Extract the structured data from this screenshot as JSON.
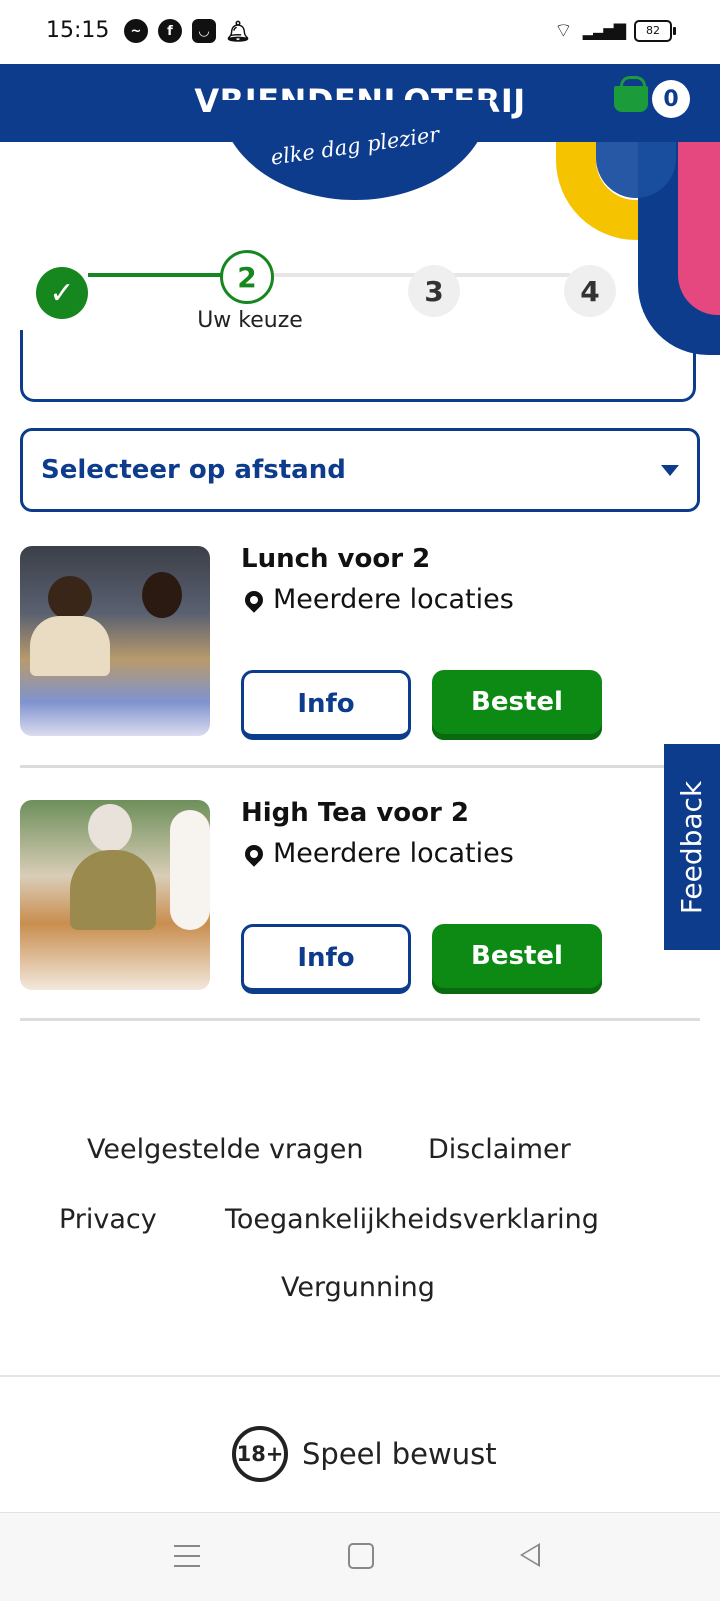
{
  "status_bar": {
    "time": "15:15",
    "battery": "82",
    "notification_icons": [
      "messenger-icon",
      "facebook-icon",
      "app-icon",
      "bell-icon"
    ]
  },
  "header": {
    "brand": "VRIENDENLOTERIJ",
    "tagline": "elke dag plezier",
    "cart_count": "0",
    "colors": {
      "brand_blue": "#0d3c8c",
      "accent_green": "#15871e",
      "yellow": "#f6c300",
      "pink": "#e5477f"
    }
  },
  "stepper": {
    "steps": [
      "1",
      "2",
      "3",
      "4"
    ],
    "current_step": "2",
    "current_label": "Uw keuze"
  },
  "filter": {
    "select_label": "Selecteer op afstand"
  },
  "products": [
    {
      "title": "Lunch voor 2",
      "location": "Meerdere locaties",
      "info_label": "Info",
      "order_label": "Bestel"
    },
    {
      "title": "High Tea voor 2",
      "location": "Meerdere locaties",
      "info_label": "Info",
      "order_label": "Bestel"
    }
  ],
  "feedback_label": "Feedback",
  "footer": {
    "links": [
      "Veelgestelde vragen",
      "Disclaimer",
      "Privacy",
      "Toegankelijkheidsverklaring",
      "Vergunning"
    ],
    "age_badge": "18+",
    "play_responsibly": "Speel bewust"
  }
}
